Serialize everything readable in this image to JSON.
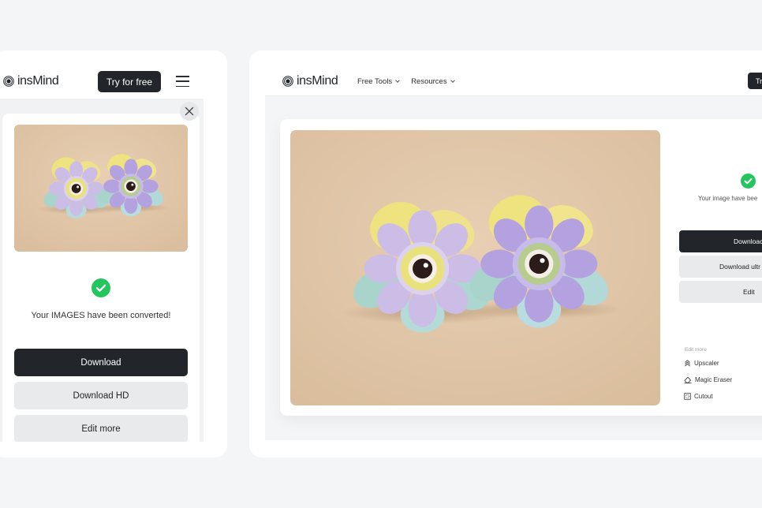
{
  "brand": {
    "name": "insMind",
    "accent": "#22252a",
    "success": "#22c55e"
  },
  "mobile": {
    "header": {
      "try_label": "Try for free"
    },
    "result": {
      "message": "Your IMAGES have been converted!",
      "download_label": "Download",
      "download_hd_label": "Download HD",
      "edit_more_label": "Edit more"
    }
  },
  "desktop": {
    "nav": [
      {
        "label": "Free Tools"
      },
      {
        "label": "Resources"
      }
    ],
    "header": {
      "try_label": "Tr"
    },
    "result": {
      "message": "Your image have bee",
      "download_label": "Downloac",
      "download_ultra_label": "Download ultr",
      "edit_label": "Edit",
      "edit_more_heading": "Edit more",
      "tools": [
        {
          "label": "Upscaler",
          "icon": "upscaler-icon"
        },
        {
          "label": "Magic Eraser",
          "icon": "eraser-icon"
        },
        {
          "label": "Cutout",
          "icon": "cutout-icon"
        }
      ]
    }
  },
  "image": {
    "alt": "Two pastel flower earrings with eye centers on beige background"
  }
}
